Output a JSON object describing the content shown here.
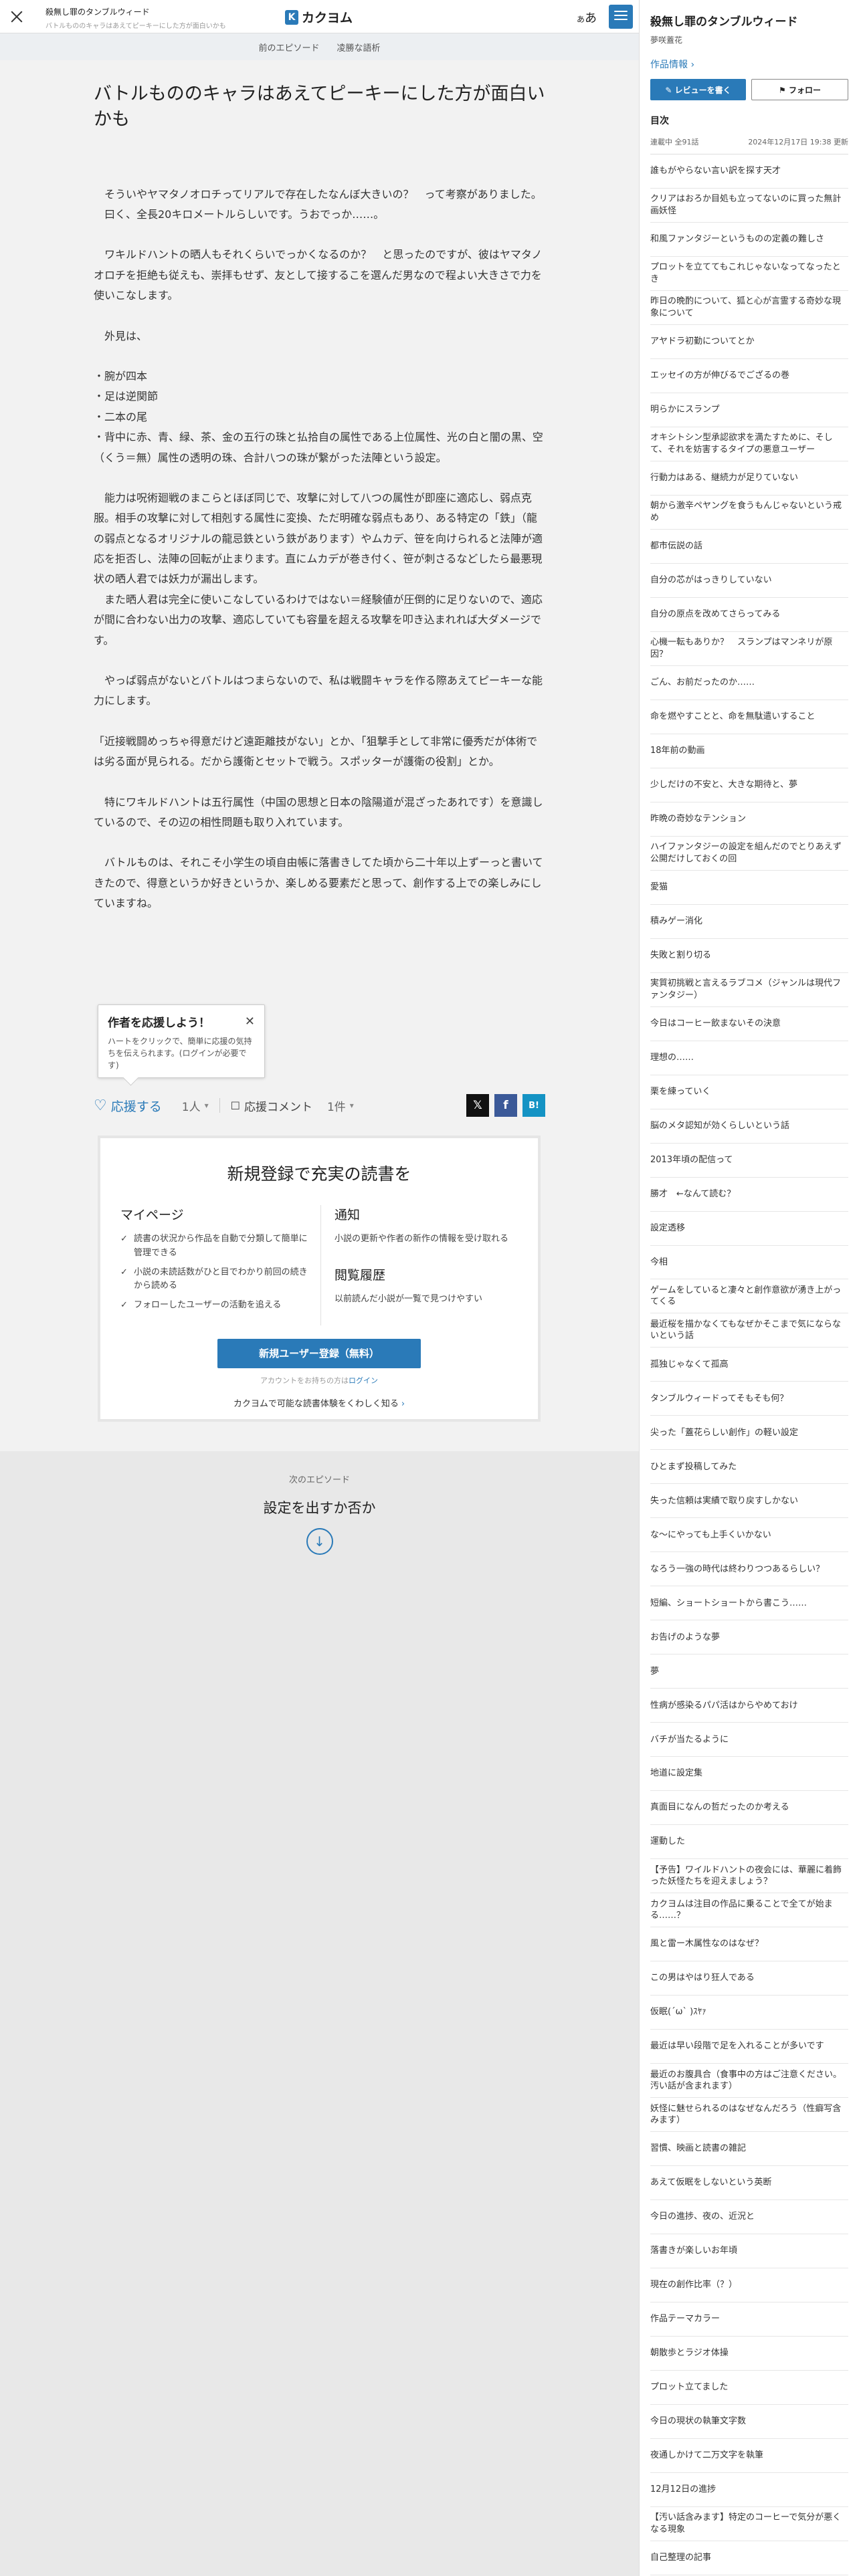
{
  "header": {
    "work_title": "殺無し罪のタンブルウィード",
    "episode_title": "バトルもののキャラはあえてピーキーにした方が面白いかも",
    "logo_mark": "K",
    "logo_text": "カクヨム",
    "font_toggle_small": "あ",
    "font_toggle_large": "あ"
  },
  "subnav": {
    "prev": "前のエピソード",
    "next": "凌勝な語析"
  },
  "article": {
    "title": "バトルもののキャラはあえてピーキーにした方が面白いかも",
    "paragraphs": [
      "",
      "　そういやヤマタノオロチってリアルで存在したなんぼ大きいの？　って考察がありました。",
      "　曰く、全長20キロメートルらしいです。うおでっか……。",
      "",
      "　ワキルドハントの晒人もそれくらいでっかくなるのか？　と思ったのですが、彼はヤマタノオロチを拒絶も従えも、崇拝もせず、友として接するこを選んだ男なので程よい大きさで力を使いこなします。",
      "",
      "　外見は、",
      "",
      "・腕が四本",
      "・足は逆関節",
      "・二本の尾",
      "・背中に赤、青、緑、茶、金の五行の珠と払拾自の属性である上位属性、光の白と闇の黒、空（くう＝無）属性の透明の珠、合計八つの珠が繋がった法陣という設定。",
      "",
      "　能力は呪術廻戦のまこらとほぼ同じで、攻撃に対して八つの属性が即座に適応し、弱点克服。相手の攻撃に対して相剋する属性に変換、ただ明確な弱点もあり、ある特定の「鉄」（龍の弱点となるオリジナルの龍忌鉄という鉄があります）やムカデ、笹を向けられると法陣が適応を拒否し、法陣の回転が止まります。直にムカデが巻き付く、笹が刺さるなどしたら最悪現状の晒人君では妖力が漏出します。",
      "　また晒人君は完全に使いこなしているわけではない＝経験値が圧倒的に足りないので、適応が間に合わない出力の攻撃、適応していても容量を超える攻撃を叩き込まれれば大ダメージです。",
      "",
      "　やっぱ弱点がないとバトルはつまらないので、私は戦闘キャラを作る際あえてピーキーな能力にします。",
      "",
      "「近接戦闘めっちゃ得意だけど遠距離技がない」とか、「狙撃手として非常に優秀だが体術では劣る面が見られる。だから護衛とセットで戦う。スポッターが護衛の役割」とか。",
      "",
      "　特にワキルドハントは五行属性（中国の思想と日本の陰陽道が混ざったあれです）を意識しているので、その辺の相性問題も取り入れています。",
      "",
      "　バトルものは、それこそ小学生の頃自由帳に落書きしてた頃から二十年以上ずーっと書いてきたので、得意というか好きというか、楽しめる要素だと思って、創作する上での楽しみにしていますね。"
    ]
  },
  "support": {
    "tooltip_title": "作者を応援しよう！",
    "tooltip_body": "ハートをクリックで、簡単に応援の気持ちを伝えられます。(ログインが必要です)",
    "tooltip_close": "✕",
    "heart_glyph": "♡",
    "label": "応援する",
    "count": "1人",
    "comment_glyph": "☐",
    "comment_label": "応援コメント",
    "comment_count": "1件",
    "share_x": "𝕏",
    "share_fb": "f",
    "share_hatena": "B!"
  },
  "signup": {
    "title": "新規登録で充実の読書を",
    "mypage_heading": "マイページ",
    "mypage_items": [
      "読書の状況から作品を自動で分類して簡単に管理できる",
      "小説の未読話数がひと目でわかり前回の続きから読める",
      "フォローしたユーザーの活動を追える"
    ],
    "notify_heading": "通知",
    "notify_desc": "小説の更新や作者の新作の情報を受け取れる",
    "history_heading": "閲覧履歴",
    "history_desc": "以前読んだ小説が一覧で見つけやすい",
    "button": "新規ユーザー登録（無料）",
    "login_prefix": "アカウントをお持ちの方は",
    "login_link": "ログイン",
    "learn_more": "カクヨムで可能な読書体験をくわしく知る",
    "learn_more_arrow": "›"
  },
  "next_episode": {
    "label": "次のエピソード",
    "title": "設定を出すか否か",
    "arrow_glyph": "↓"
  },
  "sidebar": {
    "work_title": "殺無し罪のタンブルウィード",
    "author": "夢咲蓋花",
    "info_link": "作品情報 ›",
    "review_button": "レビューを書く",
    "follow_button": "フォロー",
    "toc_heading": "目次",
    "status": "連載中 全91話",
    "updated": "2024年12月17日 19:38 更新",
    "episodes": [
      "誰もがやらない言い訳を探す天才",
      "クリアはおろか目処も立ってないのに買った無計画妖怪",
      "和風ファンタジーというものの定義の難しさ",
      "プロットを立ててもこれじゃないなってなったとき",
      "昨日の晩酌について、狐と心が言霊する奇妙な現象について",
      "アヤドラ初勤についてとか",
      "エッセイの方が伸びるでござるの巻",
      "明らかにスランプ",
      "オキシトシン型承認欲求を満たすために、そして、それを妨害するタイプの悪意ユーザー",
      "行動力はある、継続力が足りていない",
      "朝から激辛ペヤングを食うもんじゃないという戒め",
      "都市伝説の話",
      "自分の芯がはっきりしていない",
      "自分の原点を改めてさらってみる",
      "心機一転もありか？　スランプはマンネリが原因？",
      "ごん、お前だったのか……",
      "命を燃やすことと、命を無駄遣いすること",
      "18年前の動画",
      "少しだけの不安と、大きな期待と、夢",
      "昨晩の奇妙なテンション",
      "ハイファンタジーの設定を組んだのでとりあえず公開だけしておくの回",
      "愛猫",
      "積みゲー消化",
      "失敗と割り切る",
      "実質初挑戦と言えるラブコメ（ジャンルは現代ファンタジー）",
      "今日はコーヒー飲まないその決意",
      "理想の……",
      "栗を練っていく",
      "脳のメタ認知が効くらしいという話",
      "2013年頃の配信って",
      "勝才　←なんて読む？",
      "設定透移",
      "今相",
      "ゲームをしていると凄々と創作意欲が湧き上がってくる",
      "最近桜を描かなくてもなぜかそこまで気にならないという話",
      "孤独じゃなくて孤高",
      "タンブルウィードってそもそも何？",
      "尖った「蓋花らしい創作」の軽い設定",
      "ひとまず投稿してみた",
      "失った信頼は実績で取り戻すしかない",
      "な〜にやっても上手くいかない",
      "なろう一強の時代は終わりつつあるらしい？",
      "短編、ショートショートから書こう……",
      "お告げのような夢",
      "夢",
      "性病が感染るパパ活はからやめておけ",
      "バチが当たるように",
      "地道に設定集",
      "真面目になんの哲だったのか考える",
      "運動した",
      "【予告】ワイルドハントの夜会には、華麗に着飾った妖怪たちを迎えましょう？",
      "カクヨムは注目の作品に乗ることで全てが始まる……？",
      "風と雷ー木属性なのはなぜ？",
      "この男はやはり狂人である",
      "仮眠(´ω` )ｽﾔｧ",
      "最近は早い段階で足を入れることが多いです",
      "最近のお腹具合（食事中の方はご注意ください。汚い話が含まれます）",
      "妖怪に魅せられるのはなぜなんだろう（性癖写含みます）",
      "習慣、映画と読書の雑記",
      "あえて仮眠をしないという英断",
      "今日の進捗、夜の、近況と",
      "落書きが楽しいお年頃",
      "現在の創作比率（？）",
      "作品テーマカラー",
      "朝散歩とラジオ体操",
      "プロット立てました",
      "今日の現状の執筆文字数",
      "夜通しかけて二万文字を執筆",
      "12月12日の進捗",
      "【汚い話含みます】特定のコーヒーで気分が悪くなる現象",
      "自己整理の記事"
    ]
  },
  "colors": {
    "accent": "#2a7ab8",
    "x": "#111111",
    "facebook": "#3b5998",
    "hatena": "#1493c4"
  }
}
